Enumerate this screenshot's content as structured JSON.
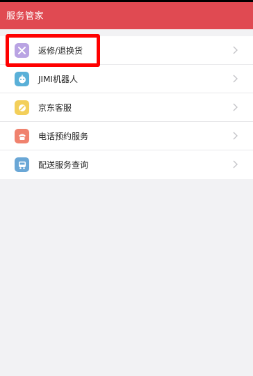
{
  "header": {
    "title": "服务管家",
    "bg_color": "#e04a52"
  },
  "menu": {
    "items": [
      {
        "label": "返修/退换货",
        "icon": "repair-tools-icon",
        "color": "#b9a3e3"
      },
      {
        "label": "JIMI机器人",
        "icon": "robot-icon",
        "color": "#5ab0d8"
      },
      {
        "label": "京东客服",
        "icon": "customer-service-icon",
        "color": "#f3cf5a"
      },
      {
        "label": "电话预约服务",
        "icon": "phone-icon",
        "color": "#f0826e"
      },
      {
        "label": "配送服务查询",
        "icon": "delivery-truck-icon",
        "color": "#6aa7d6"
      }
    ]
  },
  "highlight_color": "#ff0000"
}
